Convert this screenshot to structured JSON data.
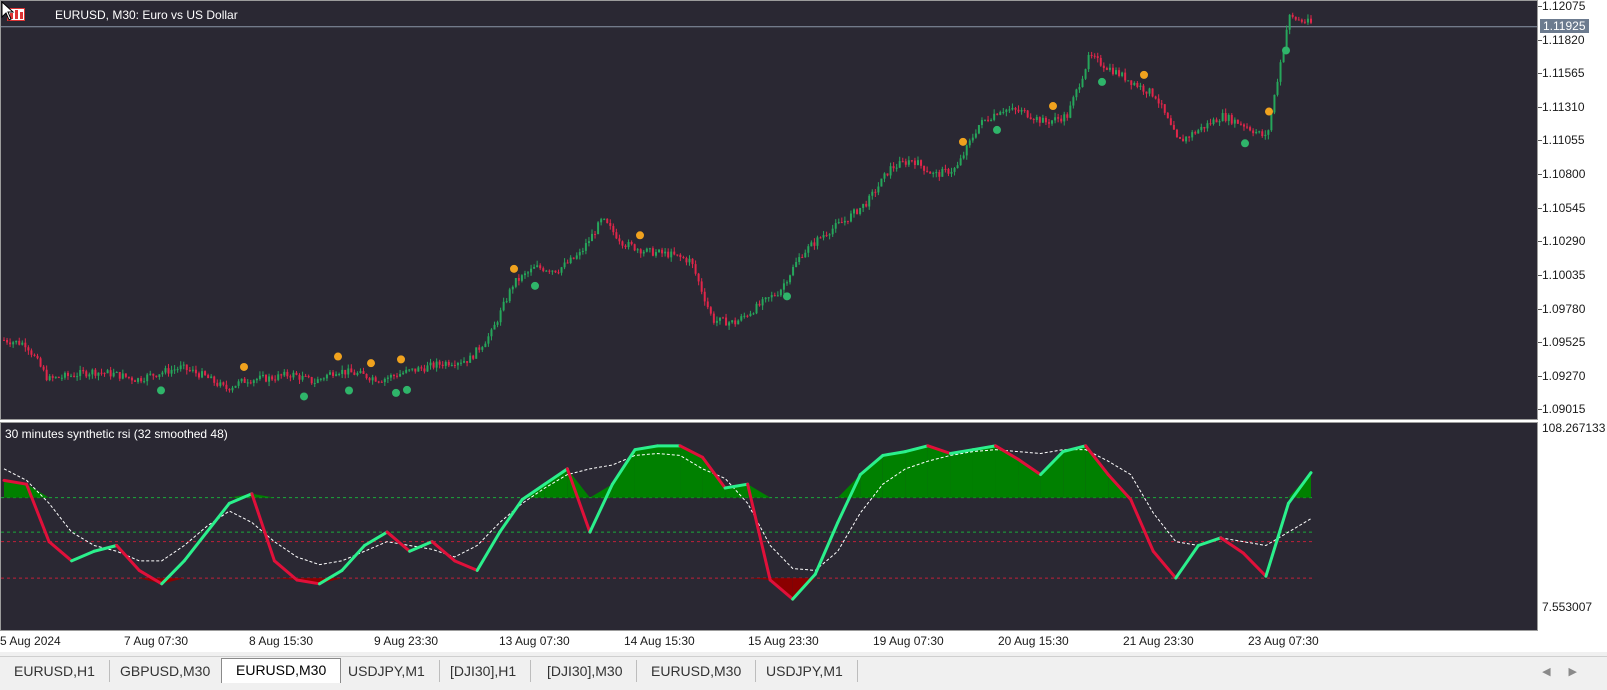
{
  "window": {
    "title": "EURUSD, M30:  Euro vs US Dollar"
  },
  "price_axis": {
    "labels": [
      "1.12075",
      "1.11820",
      "1.11565",
      "1.11310",
      "1.11055",
      "1.10800",
      "1.10545",
      "1.10290",
      "1.10035",
      "1.09780",
      "1.09525",
      "1.09270",
      "1.09015"
    ],
    "current_price": "1.11925"
  },
  "indicator": {
    "title": "30 minutes synthetic rsi (32 smoothed 48)",
    "axis_max": "108.267133",
    "axis_min": "7.553007"
  },
  "time_axis": {
    "labels": [
      "5 Aug 2024",
      "7 Aug 07:30",
      "8 Aug 15:30",
      "9 Aug 23:30",
      "13 Aug 07:30",
      "14 Aug 15:30",
      "15 Aug 23:30",
      "19 Aug 07:30",
      "20 Aug 15:30",
      "21 Aug 23:30",
      "23 Aug 07:30"
    ]
  },
  "tabs": [
    "EURUSD,H1",
    "GBPUSD,M30",
    "EURUSD,M30",
    "USDJPY,M1",
    "[DJI30],H1",
    "[DJI30],M30",
    "EURUSD,M30",
    "USDJPY,M1"
  ],
  "active_tab": 2,
  "colors": {
    "background": "#2a2833",
    "bull": "#26a65b",
    "bear": "#e0264a",
    "rsi_up": "#2bf08c",
    "rsi_down": "#e0103a",
    "fill_up": "#008000",
    "fill_down": "#8b0000",
    "arrow_up": "#2fb56a",
    "arrow_down": "#f0a21e"
  },
  "chart_data": {
    "type": "candlestick",
    "symbol": "EURUSD",
    "timeframe": "M30",
    "x_range": [
      "5 Aug 2024",
      "23 Aug 07:30"
    ],
    "ylim": [
      1.0895,
      1.12075
    ],
    "last_price": 1.11925,
    "close_path": [
      1.0955,
      1.0952,
      1.0925,
      1.0928,
      1.0931,
      1.0929,
      1.0925,
      1.093,
      1.0934,
      1.0928,
      1.0918,
      1.0925,
      1.0926,
      1.0929,
      1.0923,
      1.0932,
      1.0929,
      1.0925,
      1.093,
      1.0934,
      1.0938,
      1.094,
      1.096,
      1.0998,
      1.101,
      1.1008,
      1.102,
      1.1046,
      1.1028,
      1.1022,
      1.102,
      1.1015,
      1.097,
      1.0968,
      1.098,
      1.0992,
      1.102,
      1.1035,
      1.1046,
      1.106,
      1.1085,
      1.1092,
      1.108,
      1.1085,
      1.1118,
      1.113,
      1.1128,
      1.112,
      1.1125,
      1.117,
      1.116,
      1.115,
      1.114,
      1.1105,
      1.1115,
      1.1125,
      1.1118,
      1.1108,
      1.12,
      1.1195
    ],
    "indicator": {
      "name": "synthetic rsi",
      "ylim": [
        7.553007,
        108.267133
      ],
      "levels": [
        73,
        55,
        50,
        31
      ],
      "rsi": [
        82,
        80,
        50,
        40,
        45,
        48,
        35,
        28,
        40,
        55,
        70,
        75,
        40,
        30,
        28,
        35,
        48,
        55,
        45,
        50,
        40,
        35,
        55,
        72,
        80,
        88,
        55,
        80,
        98,
        100,
        100,
        94,
        78,
        80,
        30,
        20,
        33,
        60,
        85,
        95,
        97,
        100,
        96,
        98,
        100,
        93,
        85,
        97,
        100,
        85,
        72,
        45,
        31,
        48,
        52,
        44,
        32,
        70,
        86
      ],
      "signal": [
        88,
        82,
        70,
        55,
        48,
        45,
        40,
        40,
        48,
        58,
        66,
        60,
        50,
        42,
        38,
        40,
        45,
        50,
        48,
        46,
        42,
        48,
        60,
        70,
        78,
        85,
        88,
        90,
        95,
        96,
        95,
        88,
        83,
        70,
        48,
        36,
        35,
        45,
        65,
        80,
        88,
        92,
        95,
        97,
        98,
        97,
        96,
        98,
        98,
        92,
        85,
        65,
        50,
        48,
        52,
        50,
        48,
        55,
        62
      ]
    }
  }
}
